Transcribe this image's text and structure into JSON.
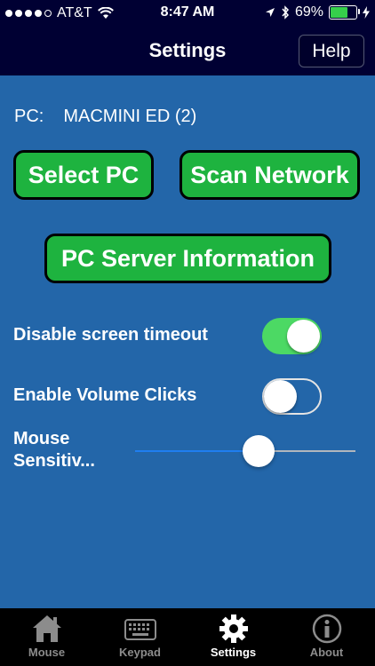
{
  "status_bar": {
    "carrier": "AT&T",
    "time": "8:47 AM",
    "battery_percent": "69%",
    "battery_level": 0.69,
    "signal_bars": 4
  },
  "nav": {
    "title": "Settings",
    "help_label": "Help"
  },
  "pc": {
    "label": "PC:",
    "name": "MACMINI ED (2)"
  },
  "buttons": {
    "select_pc": "Select PC",
    "scan_network": "Scan Network",
    "server_info": "PC Server Information"
  },
  "settings": {
    "disable_timeout_label": "Disable screen timeout",
    "disable_timeout_on": true,
    "volume_clicks_label": "Enable Volume Clicks",
    "volume_clicks_on": false,
    "mouse_sensitivity_label_line1": "Mouse",
    "mouse_sensitivity_label_line2": "Sensitiv...",
    "mouse_sensitivity_value": 0.56
  },
  "colors": {
    "background": "#2366a9",
    "nav_background": "#000033",
    "button_green": "#1eb33f",
    "toggle_on": "#4cd964",
    "slider_fill": "#1f7ef0"
  },
  "tabs": [
    {
      "label": "Mouse",
      "icon": "house-icon",
      "active": false
    },
    {
      "label": "Keypad",
      "icon": "keyboard-icon",
      "active": false
    },
    {
      "label": "Settings",
      "icon": "gear-icon",
      "active": true
    },
    {
      "label": "About",
      "icon": "info-icon",
      "active": false
    }
  ]
}
